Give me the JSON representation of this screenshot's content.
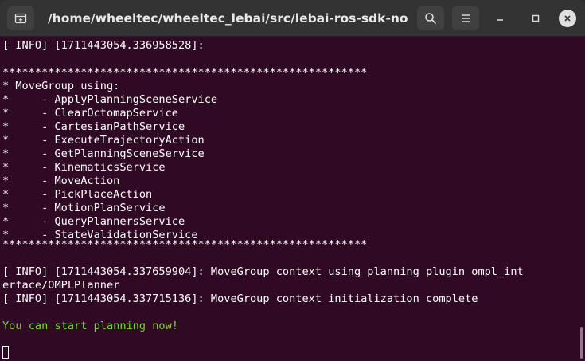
{
  "window": {
    "title": "/home/wheeltec/wheeltec_lebai/src/lebai-ros-sdk-noetic-de...",
    "buttons": {
      "new_tab_icon": "new-tab-icon",
      "search_icon": "search-icon",
      "menu_icon": "hamburger-menu-icon",
      "minimize_icon": "minimize-icon",
      "maximize_icon": "maximize-icon",
      "close_icon": "close-icon"
    }
  },
  "colors": {
    "terminal_bg": "#300a24",
    "titlebar_bg": "#333333",
    "text": "#ffffff",
    "success_text": "#7bd62d"
  },
  "terminal": {
    "lines": [
      "[ INFO] [1711443054.336958528]:",
      "",
      "********************************************************",
      "* MoveGroup using:",
      "*     - ApplyPlanningSceneService",
      "*     - ClearOctomapService",
      "*     - CartesianPathService",
      "*     - ExecuteTrajectoryAction",
      "*     - GetPlanningSceneService",
      "*     - KinematicsService",
      "*     - MoveAction",
      "*     - PickPlaceAction",
      "*     - MotionPlanService",
      "*     - QueryPlannersService",
      "*     - StateValidationService",
      "********************************************************",
      "",
      "[ INFO] [1711443054.337659904]: MoveGroup context using planning plugin ompl_int",
      "erface/OMPLPlanner",
      "[ INFO] [1711443054.337715136]: MoveGroup context initialization complete",
      "",
      "You can start planning now!"
    ]
  }
}
